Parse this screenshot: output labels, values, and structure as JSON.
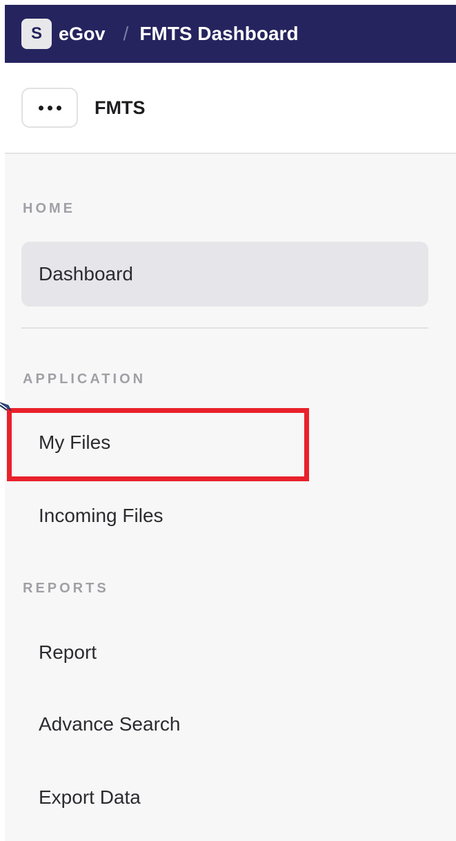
{
  "topbar": {
    "logo_letter": "S",
    "brand": "eGov",
    "separator": "/",
    "title": "FMTS Dashboard",
    "background_color": "#26245e"
  },
  "app_header": {
    "more_button_icon": "more-horizontal-icon",
    "app_name": "FMTS"
  },
  "sidebar": {
    "sections": [
      {
        "label": "HOME",
        "items": [
          {
            "label": "Dashboard",
            "active": true
          }
        ]
      },
      {
        "label": "APPLICATION",
        "items": [
          {
            "label": "My Files",
            "highlighted": true
          },
          {
            "label": "Incoming Files"
          }
        ]
      },
      {
        "label": "REPORTS",
        "items": [
          {
            "label": "Report"
          },
          {
            "label": "Advance Search"
          },
          {
            "label": "Export Data"
          }
        ]
      }
    ]
  },
  "annotation": {
    "highlight_color": "#e8212b"
  }
}
